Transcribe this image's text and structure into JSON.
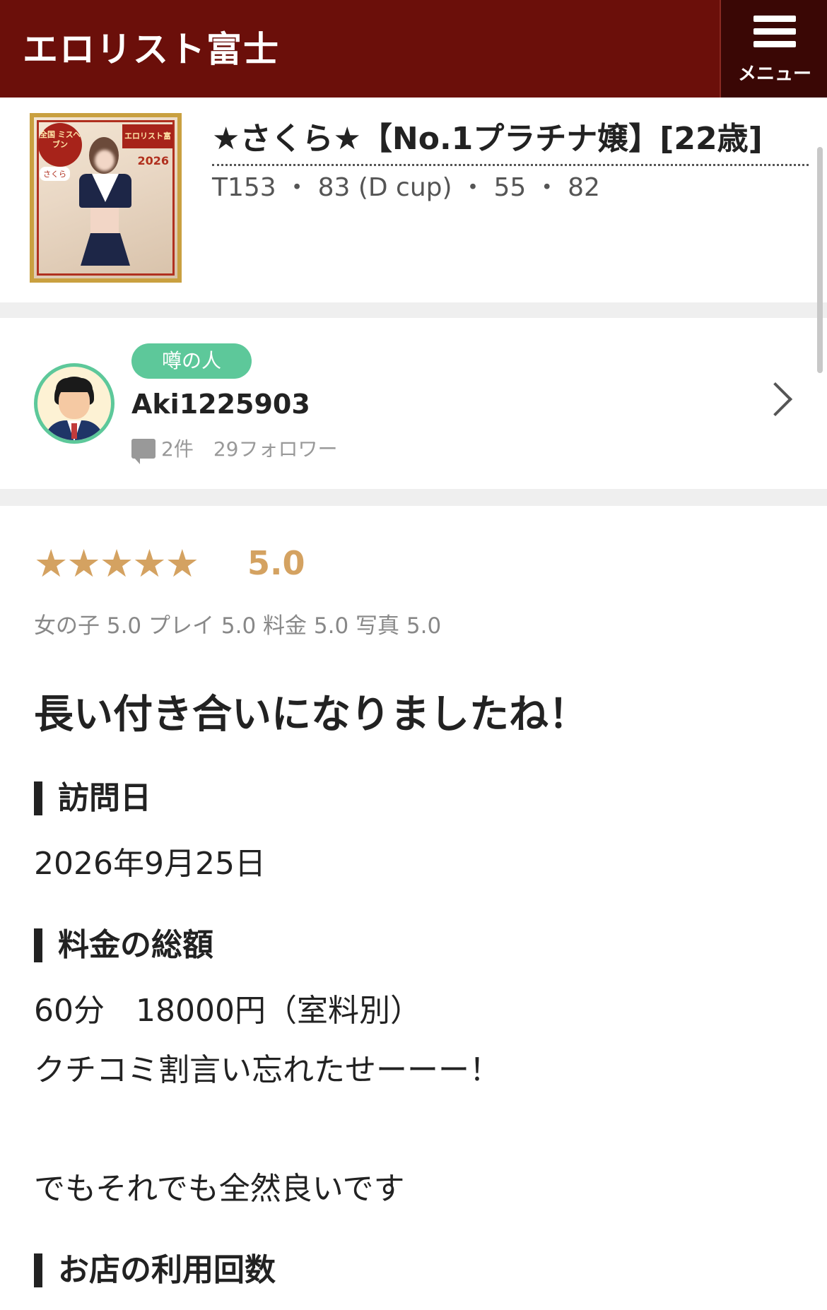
{
  "header": {
    "title": "エロリスト富士",
    "menu_label": "メニュー"
  },
  "profile": {
    "name": "★さくら★【No.1プラチナ嬢】[22歳]",
    "specs": "T153 ・ 83 (D cup) ・ 55 ・ 82",
    "thumb_text": {
      "badge_left": "全国 ミスヘブン",
      "badge_right": "エロリスト富士",
      "year": "2026",
      "tag": "さくら"
    }
  },
  "reviewer": {
    "rank": "噂の人",
    "name": "Aki1225903",
    "meta": "2件　29フォロワー"
  },
  "review": {
    "stars": "★★★★★",
    "score": "5.0",
    "sub_scores": "女の子 5.0 プレイ 5.0 料金 5.0 写真 5.0",
    "title": "長い付き合いになりましたね！",
    "sections": [
      {
        "heading": "訪問日",
        "lines": [
          "2026年9月25日"
        ]
      },
      {
        "heading": "料金の総額",
        "lines": [
          "60分　18000円（室料別）",
          "クチコミ割言い忘れたせーーー！",
          "",
          "でもそれでも全然良いです"
        ]
      },
      {
        "heading": "お店の利用回数",
        "lines": []
      }
    ]
  },
  "colors": {
    "header_bg": "#6b0f0a",
    "accent_green": "#5dc89a",
    "star_gold": "#d4a261"
  }
}
